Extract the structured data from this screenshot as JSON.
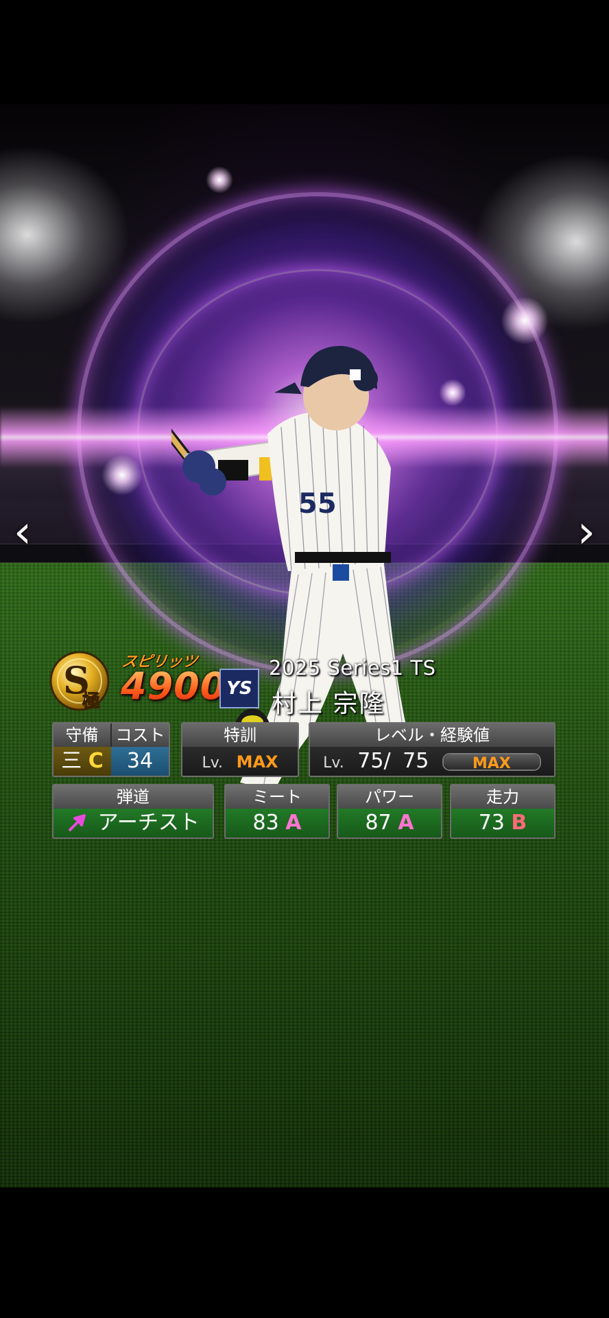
{
  "card": {
    "spirits_label": "スピリッツ",
    "spirits_value": "4900",
    "rank_badge": {
      "letter": "S",
      "sub": "極"
    },
    "team_logo_text": "YS",
    "series": "2025 Series1 TS",
    "player_name": "村上 宗隆"
  },
  "nav": {
    "prev_icon": "‹",
    "next_icon": "›"
  },
  "stats": {
    "position": {
      "header": "守備",
      "value": "三",
      "grade": "C"
    },
    "cost": {
      "header": "コスト",
      "value": "34"
    },
    "tokkun": {
      "header": "特訓",
      "lv_label": "Lv.",
      "value": "MAX"
    },
    "level": {
      "header": "レベル・経験値",
      "lv_label": "Lv.",
      "current": "75",
      "separator": "/",
      "max": "75",
      "exp_label": "MAX",
      "exp_fill": 1.0
    },
    "trajectory": {
      "header": "弾道",
      "icon": "diagonal-arrow-icon",
      "value": "アーチスト"
    },
    "meet": {
      "header": "ミート",
      "value": "83",
      "grade": "A"
    },
    "power": {
      "header": "パワー",
      "value": "87",
      "grade": "A"
    },
    "speed": {
      "header": "走力",
      "value": "73",
      "grade": "B"
    }
  },
  "colors": {
    "accent_orange": "#ff9a1c",
    "grade_a": "#ff73d1",
    "grade_b": "#ff6b7a",
    "green_box": "#1f6b22",
    "orb_purple": "#a050ff"
  }
}
